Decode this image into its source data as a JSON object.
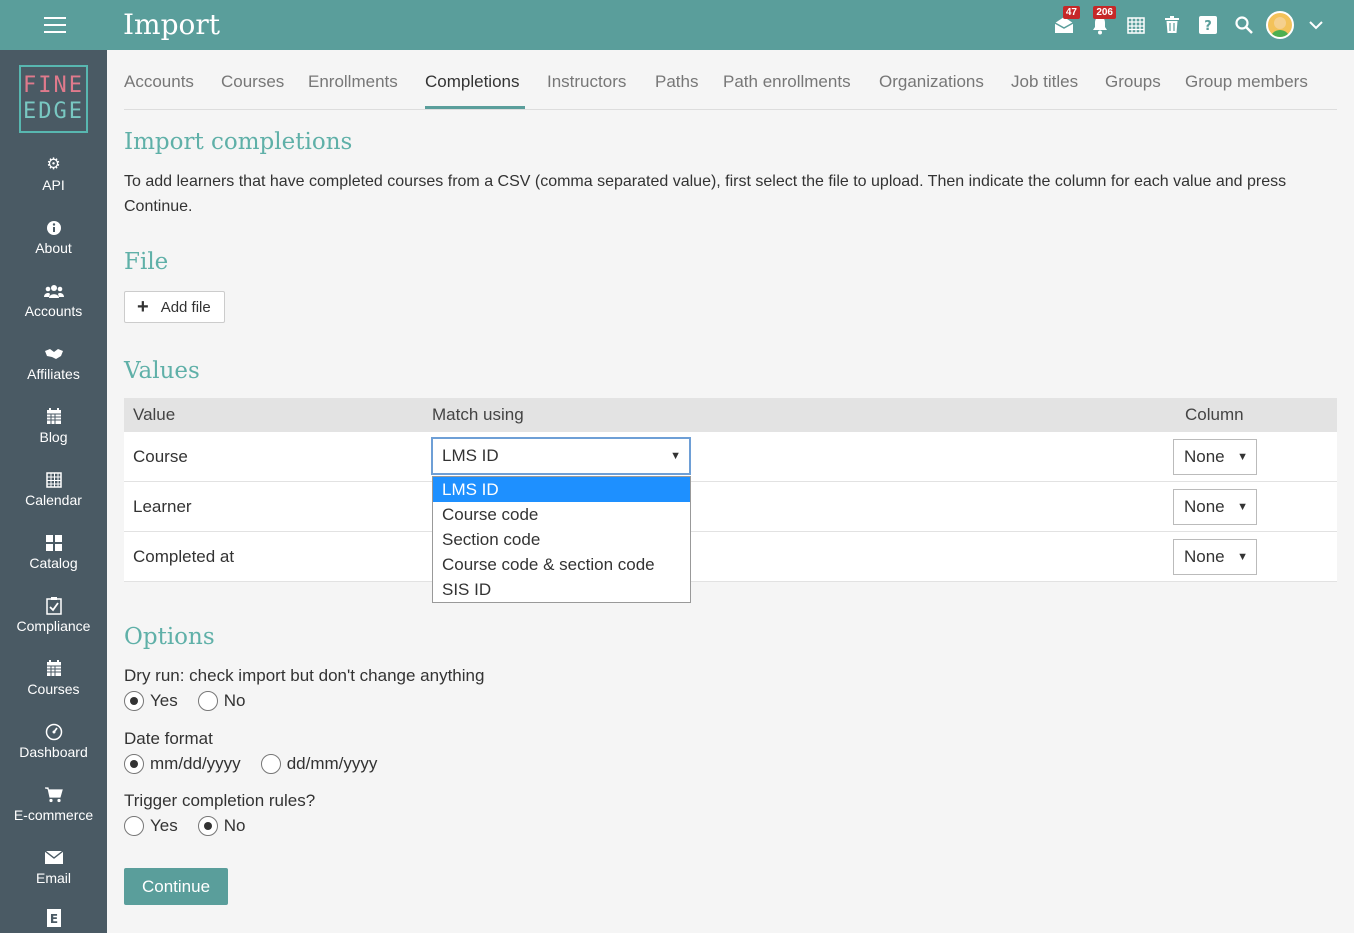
{
  "header": {
    "title": "Import",
    "messages_badge": "47",
    "notifications_badge": "206"
  },
  "logo": {
    "line1": "FINE",
    "line2": "EDGE"
  },
  "sidebar": {
    "items": [
      {
        "label": "API",
        "icon": "gear-icon"
      },
      {
        "label": "About",
        "icon": "info-icon"
      },
      {
        "label": "Accounts",
        "icon": "users-icon"
      },
      {
        "label": "Affiliates",
        "icon": "handshake-icon"
      },
      {
        "label": "Blog",
        "icon": "calendar-icon"
      },
      {
        "label": "Calendar",
        "icon": "grid-calendar-icon"
      },
      {
        "label": "Catalog",
        "icon": "catalog-icon"
      },
      {
        "label": "Compliance",
        "icon": "clipboard-check-icon"
      },
      {
        "label": "Courses",
        "icon": "calendar-icon"
      },
      {
        "label": "Dashboard",
        "icon": "dashboard-icon"
      },
      {
        "label": "E-commerce",
        "icon": "cart-icon"
      },
      {
        "label": "Email",
        "icon": "envelope-icon"
      }
    ]
  },
  "tabs": [
    "Accounts",
    "Courses",
    "Enrollments",
    "Completions",
    "Instructors",
    "Paths",
    "Path enrollments",
    "Organizations",
    "Job titles",
    "Groups",
    "Group members"
  ],
  "active_tab": "Completions",
  "main": {
    "heading": "Import completions",
    "intro": "To add learners that have completed courses from a CSV (comma separated value), first select the file to upload. Then indicate the column for each value and press Continue.",
    "file_heading": "File",
    "add_file_label": "Add file",
    "values_heading": "Values",
    "table": {
      "headers": [
        "Value",
        "Match using",
        "Column"
      ],
      "rows": [
        {
          "value": "Course",
          "match": "LMS ID",
          "column": "None"
        },
        {
          "value": "Learner",
          "column": "None"
        },
        {
          "value": "Completed at",
          "column": "None"
        }
      ]
    },
    "dropdown_options": [
      "LMS ID",
      "Course code",
      "Section code",
      "Course code & section code",
      "SIS ID"
    ],
    "dropdown_selected": "LMS ID",
    "options_heading": "Options",
    "dry_run": {
      "label": "Dry run: check import but don't change anything",
      "options": [
        "Yes",
        "No"
      ],
      "selected": "Yes"
    },
    "date_format": {
      "label": "Date format",
      "options": [
        "mm/dd/yyyy",
        "dd/mm/yyyy"
      ],
      "selected": "mm/dd/yyyy"
    },
    "trigger": {
      "label": "Trigger completion rules?",
      "options": [
        "Yes",
        "No"
      ],
      "selected": "No"
    },
    "continue_label": "Continue"
  }
}
